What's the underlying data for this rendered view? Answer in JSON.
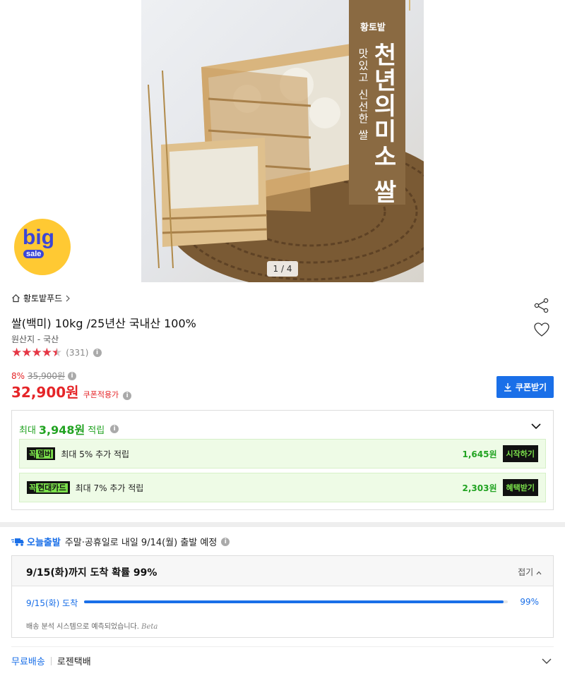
{
  "hero": {
    "counter": "1 / 4",
    "banner_brand": "황토밭",
    "banner_big": "천년의미소 쌀",
    "banner_small": "맛있고 신선한 쌀"
  },
  "badge": {
    "big": "big",
    "sale": "sale"
  },
  "product": {
    "brand": "황토밭푸드",
    "title": "쌀(백미) 10kg /25년산 국내산 100%",
    "origin": "원산지 - 국산",
    "rating": 4.5,
    "review_count": "(331)",
    "discount_rate": "8%",
    "original_price": "35,900원",
    "price": "32,900원",
    "price_note": "쿠폰적용가"
  },
  "coupon": {
    "label": "쿠폰받기"
  },
  "reward": {
    "prefix": "최대",
    "amount": "3,948원",
    "suffix": "적립",
    "rows": [
      {
        "tag_a": "꼭",
        "tag_b": "멤버",
        "desc": "최대 5% 추가 적립",
        "amount": "1,645원",
        "action": "시작하기"
      },
      {
        "tag_a": "꼭",
        "tag_b": "현대카드",
        "desc": "최대 7% 추가 적립",
        "amount": "2,303원",
        "action": "혜택받기"
      }
    ]
  },
  "shipping": {
    "badge": "오늘출발",
    "text": "주말·공휴일로 내일 9/14(월) 출발 예정",
    "arrival_title": "9/15(화)까지 도착 확률 99%",
    "fold_label": "접기",
    "arrival_date": "9/15(화) 도착",
    "arrival_percent": "99%",
    "arrival_fraction": 0.99,
    "note": "배송 분석 시스템으로 예측되었습니다.",
    "note_beta": "Beta",
    "free_label": "무료배송",
    "carrier": "로젠택배"
  },
  "colors": {
    "accent": "#1a6fe8",
    "price": "#e52528",
    "reward": "#22a322"
  }
}
